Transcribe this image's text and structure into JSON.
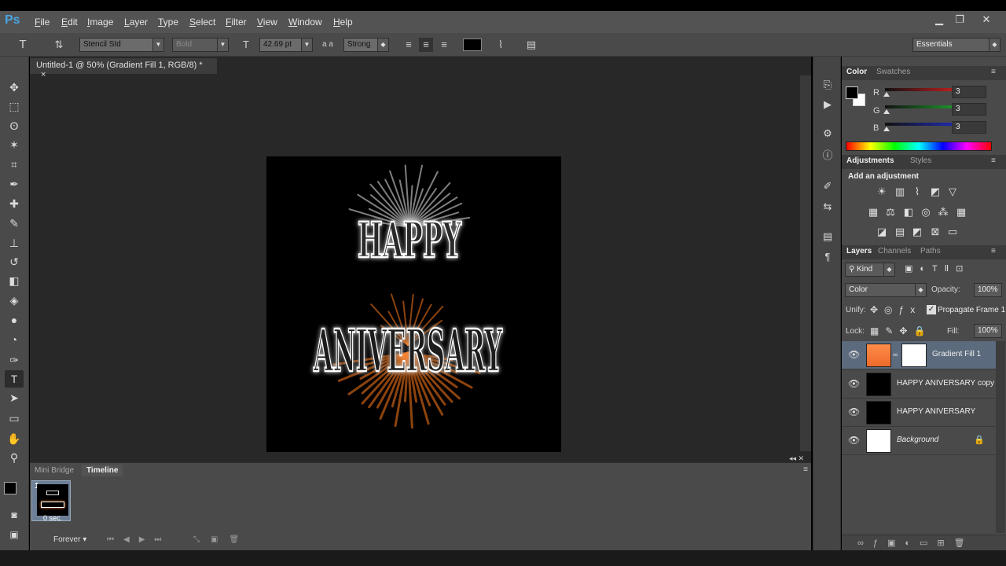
{
  "app": {
    "logo": "Ps"
  },
  "menu": [
    "File",
    "Edit",
    "Image",
    "Layer",
    "Type",
    "Select",
    "Filter",
    "View",
    "Window",
    "Help"
  ],
  "window_controls": {
    "minimize": "▁",
    "restore": "❐",
    "close": "✕"
  },
  "options": {
    "tool_glyph": "T",
    "font_family": "Stencil Std",
    "font_style": "Bold",
    "font_size": "42.69 pt",
    "antialias_label": "a a",
    "antialias": "Strong",
    "text_color": "#000000",
    "workspace": "Essentials"
  },
  "document": {
    "tab_title": "Untitled-1 @ 50% (Gradient Fill 1, RGB/8) *",
    "close_glyph": "×",
    "canvas_text_line1": "HAPPY",
    "canvas_text_line2": "ANIVERSARY",
    "glow_color": "#ff7a1a"
  },
  "timeline": {
    "tabs": [
      "Mini Bridge",
      "Timeline"
    ],
    "active_tab": "Timeline",
    "frame_number": "1",
    "frame_delay": "0 sec.",
    "loop": "Forever"
  },
  "color_panel": {
    "tabs": [
      "Color",
      "Swatches"
    ],
    "channels": [
      {
        "label": "R",
        "value": "3",
        "color": "#e02020"
      },
      {
        "label": "G",
        "value": "3",
        "color": "#20b030"
      },
      {
        "label": "B",
        "value": "3",
        "color": "#2030d0"
      }
    ]
  },
  "adjustments_panel": {
    "tabs": [
      "Adjustments",
      "Styles"
    ],
    "heading": "Add an adjustment"
  },
  "layers_panel": {
    "tabs": [
      "Layers",
      "Channels",
      "Paths"
    ],
    "filter_kind": "Kind",
    "blend_mode": "Color",
    "opacity_label": "Opacity:",
    "opacity": "100%",
    "unify_label": "Unify:",
    "propagate_label": "Propagate Frame 1",
    "lock_label": "Lock:",
    "fill_label": "Fill:",
    "fill": "100%",
    "layers": [
      {
        "name": "Gradient Fill 1",
        "selected": true
      },
      {
        "name": "HAPPY ANIVERSARY copy",
        "selected": false
      },
      {
        "name": "HAPPY ANIVERSARY",
        "selected": false
      },
      {
        "name": "Background",
        "selected": false,
        "locked": true
      }
    ]
  }
}
